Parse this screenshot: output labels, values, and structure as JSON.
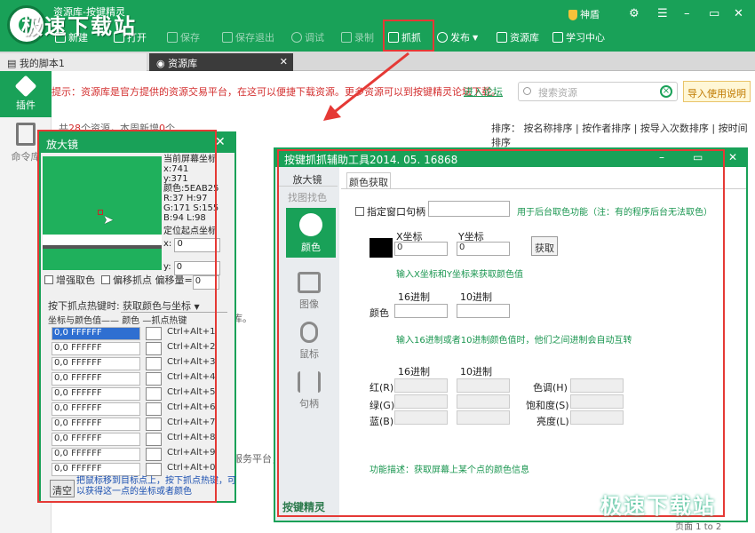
{
  "window": {
    "title": "资源库-按键精灵"
  },
  "watermark": {
    "text": "极速下载站"
  },
  "toolbar": {
    "items": [
      "新建",
      "打开",
      "保存",
      "保存退出",
      "调试",
      "录制",
      "抓抓",
      "发布",
      "资源库",
      "学习中心"
    ],
    "shield_label": "神盾"
  },
  "tabs": [
    "我的脚本1",
    "资源库"
  ],
  "sidebar": {
    "plugin": "插件",
    "command_lib": "命令库"
  },
  "notice": {
    "text": "提示：资源库是官方提供的资源交易平台，在这可以便捷下载资源。更多资源可以到按键精灵论坛下载。",
    "link": "进入论坛"
  },
  "search": {
    "placeholder": "搜索资源"
  },
  "import_help": "导入使用说明",
  "list": {
    "count_prefix": "共",
    "count": "28",
    "count_mid": "个资源，本周新增",
    "week_new": "0",
    "count_suffix": "个",
    "sort_label": "排序：",
    "sort_options": [
      "按名称排序",
      "按作者排序",
      "按导入次数排序",
      "按时间排序"
    ],
    "page_info": "页面 1 to 2",
    "bg_fragment_1": "库。",
    "bg_fragment_2": "服务平台，"
  },
  "magnifier": {
    "title": "放大镜",
    "info_lines": [
      "当前屏幕坐标",
      "x:741",
      "y:371",
      "颜色:5EAB25",
      "R:37  H:97",
      "G:171  S:155",
      "B:94  L:98"
    ],
    "origin_label": "定位起点坐标",
    "origin_x": "0",
    "origin_y": "0",
    "enhance_label": "增强取色",
    "offset_label": "偏移抓点",
    "offset_amount_label": "偏移量=",
    "offset_amount": "0",
    "hotkey_label": "按下抓点热键时:",
    "hotkey_action": "获取颜色与坐标",
    "col_coord": "坐标与颜色值",
    "col_color": "颜色",
    "col_hotkey": "抓点热键",
    "rows": [
      {
        "value": "0,0  FFFFFF",
        "key": "Ctrl+Alt+1"
      },
      {
        "value": "0,0  FFFFFF",
        "key": "Ctrl+Alt+2"
      },
      {
        "value": "0,0  FFFFFF",
        "key": "Ctrl+Alt+3"
      },
      {
        "value": "0,0  FFFFFF",
        "key": "Ctrl+Alt+4"
      },
      {
        "value": "0,0  FFFFFF",
        "key": "Ctrl+Alt+5"
      },
      {
        "value": "0,0  FFFFFF",
        "key": "Ctrl+Alt+6"
      },
      {
        "value": "0,0  FFFFFF",
        "key": "Ctrl+Alt+7"
      },
      {
        "value": "0,0  FFFFFF",
        "key": "Ctrl+Alt+8"
      },
      {
        "value": "0,0  FFFFFF",
        "key": "Ctrl+Alt+9"
      },
      {
        "value": "0,0  FFFFFF",
        "key": "Ctrl+Alt+0"
      }
    ],
    "clear_label": "清空",
    "tip": "把鼠标移到目标点上，按下抓点热键，可以获得这一点的坐标或者颜色"
  },
  "capture": {
    "title": "按键抓抓辅助工具2014. 05. 16868",
    "side_tabs": [
      "放大镜",
      "找图找色"
    ],
    "side_items": [
      "颜色",
      "图像",
      "鼠标",
      "句柄"
    ],
    "brand": "按键精灵",
    "tab": "颜色获取",
    "handle_label": "指定窗口句柄",
    "handle_hint": "用于后台取色功能（注：有的程序后台无法取色）",
    "x_label": "X坐标",
    "y_label": "Y坐标",
    "x_value": "0",
    "y_value": "0",
    "pick_label": "获取",
    "hint1": "输入X坐标和Y坐标来获取颜色值",
    "hex_label": "16进制",
    "dec_label": "10进制",
    "color_label": "颜色",
    "hint2": "输入16进制或者10进制颜色值时，他们之间进制会自动互转",
    "red": "红(R)",
    "green": "绿(G)",
    "blue": "蓝(B)",
    "hue": "色调(H)",
    "sat": "饱和度(S)",
    "lum": "亮度(L)",
    "desc": "功能描述：获取屏幕上某个点的颜色信息"
  },
  "colors": {
    "brand": "#19A158",
    "highlight": "#E53935",
    "notice": "#D32F2F"
  }
}
